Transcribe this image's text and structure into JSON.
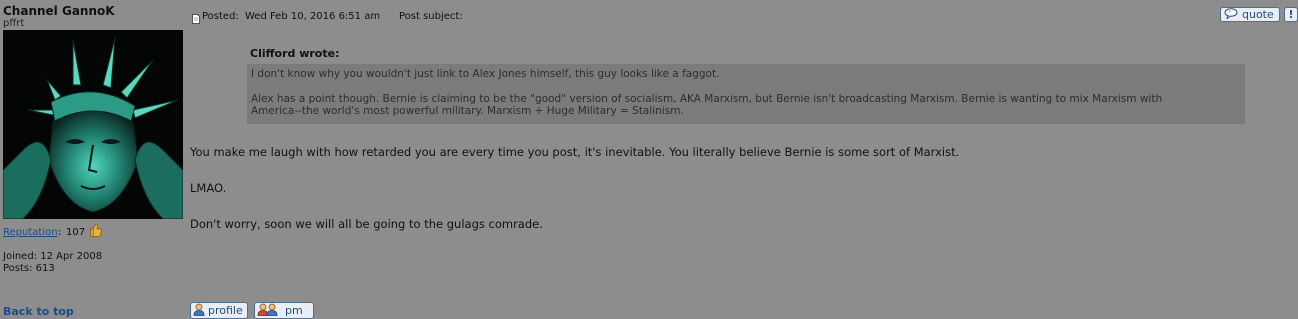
{
  "author": {
    "name": "Channel GannoK",
    "title": "pffrt",
    "reputation_label": "Reputation",
    "reputation_colon": ":",
    "reputation_value": "107",
    "joined": "Joined: 12 Apr 2008",
    "posts": "Posts: 613"
  },
  "post": {
    "posted_label": "Posted:",
    "posted_date": "Wed Feb 10, 2016 6:51 am",
    "subject_label": "Post subject:"
  },
  "quote": {
    "author": "Clifford wrote:",
    "line1": "I don't know why you wouldn't just link to Alex Jones himself, this guy looks like a faggot.",
    "line2a": "Alex has a point though. Bernie is claiming to be the \"good\" version of socialism, AKA Marxism, but Bernie isn't broadcasting Marxism. Bernie is wanting to mix Marxism with",
    "line2b": "America--the world's most powerful military. Marxism + Huge Military = Stalinism."
  },
  "message": {
    "line1": "You make me laugh with how retarded you are every time you post, it's inevitable. You literally believe Bernie is some sort of Marxist.",
    "line2": "LMAO.",
    "line3": "Don't worry, soon we will all be going to the gulags comrade."
  },
  "buttons": {
    "quote": "quote",
    "warn": "!",
    "profile": "profile",
    "pm": "pm",
    "back_to_top": "Back to top"
  },
  "icons": {
    "post": "post-icon",
    "quote": "quote-bubble-icon",
    "profile": "user-icon",
    "pm": "users-icon",
    "reputation": "thumbs-up-icon",
    "avatar": "statue-of-liberty-avatar"
  },
  "colors": {
    "background": "#8d8d8d",
    "link": "#1a4c8a",
    "quote_box": "#7b7b7b",
    "button_bg": "#e9eef4"
  }
}
